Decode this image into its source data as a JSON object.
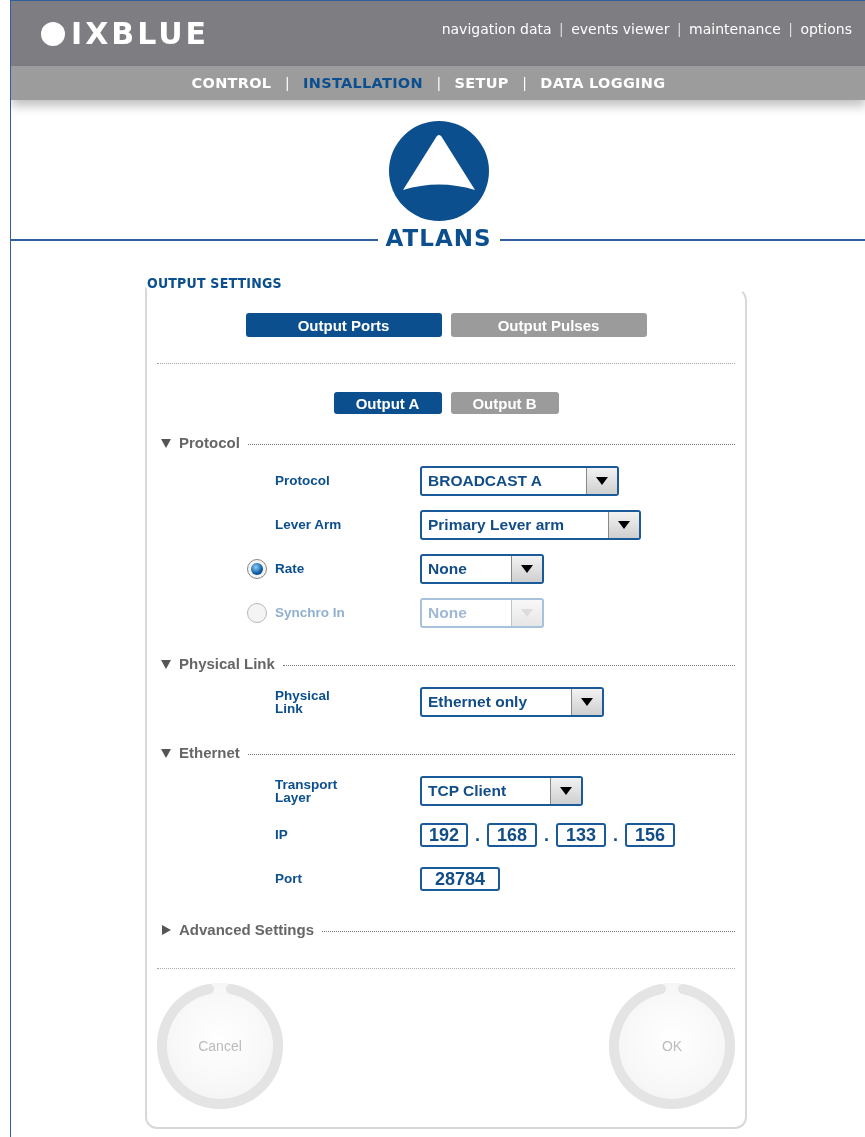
{
  "header": {
    "logo": "IXBLUE",
    "links": [
      "navigation data",
      "events viewer",
      "maintenance",
      "options"
    ],
    "separator": "|"
  },
  "nav": [
    {
      "label": "CONTROL",
      "selected": false
    },
    {
      "label": "INSTALLATION",
      "selected": true
    },
    {
      "label": "SETUP",
      "selected": false
    },
    {
      "label": "DATA LOGGING",
      "selected": false
    }
  ],
  "product": "ATLANS",
  "panel": {
    "title": "OUTPUT SETTINGS",
    "tabs": [
      {
        "label": "Output Ports",
        "selected": true
      },
      {
        "label": "Output Pulses",
        "selected": false
      }
    ],
    "subtabs": [
      {
        "label": "Output A",
        "selected": true
      },
      {
        "label": "Output B",
        "selected": false
      }
    ],
    "sections": [
      {
        "title": "Protocol",
        "expanded": true,
        "rows": [
          {
            "kind": "select",
            "label": "Protocol",
            "value": "BROADCAST A"
          },
          {
            "kind": "select",
            "label": "Lever Arm",
            "value": "Primary Lever arm"
          },
          {
            "kind": "radio-select",
            "label": "Rate",
            "value": "None",
            "selected": true,
            "disabled": false
          },
          {
            "kind": "radio-select",
            "label": "Synchro In",
            "value": "None",
            "selected": false,
            "disabled": true
          }
        ]
      },
      {
        "title": "Physical Link",
        "expanded": true,
        "rows": [
          {
            "kind": "select",
            "label": "Physical Link",
            "value": "Ethernet only"
          }
        ]
      },
      {
        "title": "Ethernet",
        "expanded": true,
        "rows": [
          {
            "kind": "select",
            "label": "Transport Layer",
            "value": "TCP Client"
          },
          {
            "kind": "ip",
            "label": "IP",
            "octets": [
              "192",
              "168",
              "133",
              "156"
            ],
            "separator": "."
          },
          {
            "kind": "text",
            "label": "Port",
            "value": "28784"
          }
        ]
      },
      {
        "title": "Advanced Settings",
        "expanded": false
      }
    ],
    "buttons": [
      "Cancel",
      "OK"
    ]
  }
}
